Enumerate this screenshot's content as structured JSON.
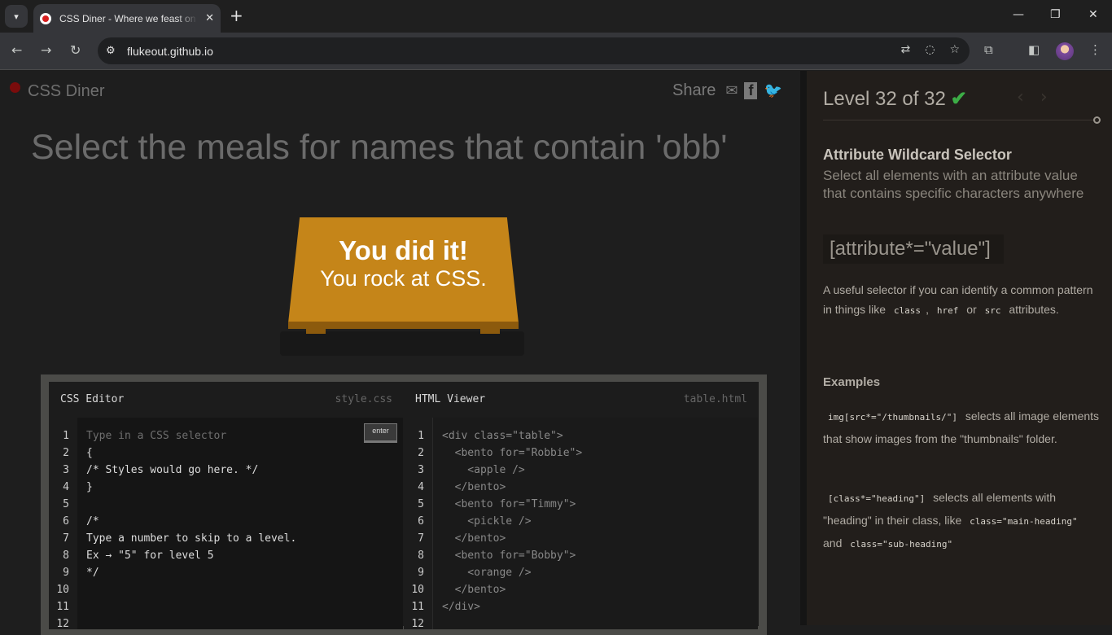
{
  "browser": {
    "tab_title": "CSS Diner - Where we feast on CSS",
    "url": "flukeout.github.io"
  },
  "header": {
    "logo_text": "CSS Diner",
    "share_label": "Share"
  },
  "order": "Select the meals for names that contain 'obb'",
  "win": {
    "line1": "You did it!",
    "line2": "You rock at CSS."
  },
  "css_editor": {
    "title": "CSS Editor",
    "file": "style.css",
    "enter_label": "enter",
    "placeholder": "Type in a CSS selector",
    "lines": [
      "{",
      "/* Styles would go here. */",
      "}",
      "",
      "/*",
      "Type a number to skip to a level.",
      "Ex → \"5\" for level 5",
      "*/",
      "",
      "",
      ""
    ],
    "line_numbers": [
      "1",
      "2",
      "3",
      "4",
      "5",
      "6",
      "7",
      "8",
      "9",
      "10",
      "11",
      "12"
    ]
  },
  "html_viewer": {
    "title": "HTML Viewer",
    "file": "table.html",
    "lines": [
      "<div class=\"table\">",
      "  <bento for=\"Robbie\">",
      "    <apple />",
      "  </bento>",
      "  <bento for=\"Timmy\">",
      "    <pickle />",
      "  </bento>",
      "  <bento for=\"Bobby\">",
      "    <orange />",
      "  </bento>",
      "</div>",
      ""
    ],
    "line_numbers": [
      "1",
      "2",
      "3",
      "4",
      "5",
      "6",
      "7",
      "8",
      "9",
      "10",
      "11",
      "12"
    ]
  },
  "sidebar": {
    "level_text": "Level 32 of 32",
    "selector_name": "Attribute Wildcard Selector",
    "title": "Select all elements with an attribute value that contains specific characters anywhere",
    "syntax": "[attribute*=\"value\"]",
    "hint_pre": "A useful selector if you can identify a common pattern in things like",
    "hint_tag1": "class",
    "hint_sep": ",",
    "hint_tag2": "href",
    "hint_or": "or",
    "hint_tag3": "src",
    "hint_post": "attributes.",
    "examples_heading": "Examples",
    "example1_code": "img[src*=\"/thumbnails/\"]",
    "example1_text": "selects all image elements that show images from the \"thumbnails\" folder.",
    "example2_code": "[class*=\"heading\"]",
    "example2_text": "selects all elements with \"heading\" in their class, like",
    "example2_tag1": "class=\"main-heading\"",
    "example2_and": "and",
    "example2_tag2": "class=\"sub-heading\""
  }
}
